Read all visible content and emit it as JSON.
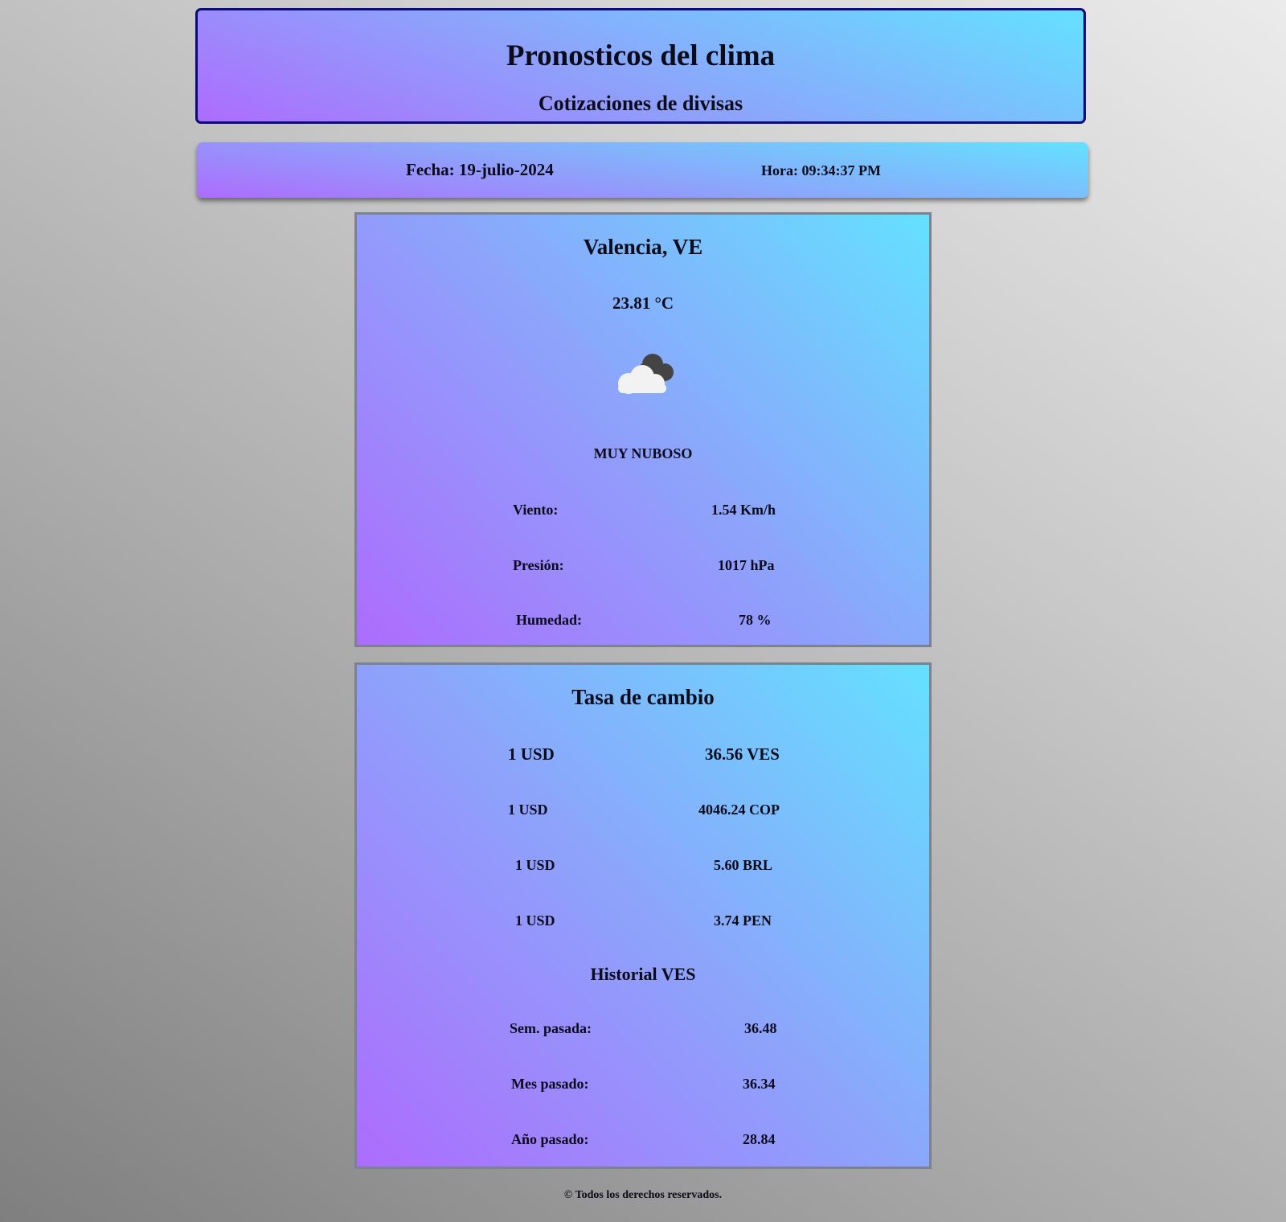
{
  "header": {
    "title": "Pronosticos del clima",
    "subtitle": "Cotizaciones de divisas"
  },
  "datetime": {
    "date": "Fecha: 19-julio-2024",
    "time": "Hora: 09:34:37 PM"
  },
  "weather": {
    "city": "Valencia, VE",
    "temperature": "23.81 °C",
    "icon": "cloudy-icon",
    "condition": "MUY NUBOSO",
    "rows": [
      {
        "label": "Viento:",
        "value": "1.54 Km/h"
      },
      {
        "label": "Presión:",
        "value": "1017 hPa"
      },
      {
        "label": "Humedad:",
        "value": "78 %"
      }
    ]
  },
  "rates": {
    "title": "Tasa de cambio",
    "items": [
      {
        "base": "1 USD",
        "value": "36.56 VES"
      },
      {
        "base": "1 USD",
        "value": "4046.24 COP"
      },
      {
        "base": "1 USD",
        "value": "5.60 BRL"
      },
      {
        "base": "1 USD",
        "value": "3.74 PEN"
      }
    ],
    "history_title": "Historial VES",
    "history": [
      {
        "label": "Sem. pasada:",
        "value": "36.48"
      },
      {
        "label": "Mes pasado:",
        "value": "36.34"
      },
      {
        "label": "Año pasado:",
        "value": "28.84"
      }
    ]
  },
  "footer": {
    "text": "© Todos los derechos reservados."
  }
}
